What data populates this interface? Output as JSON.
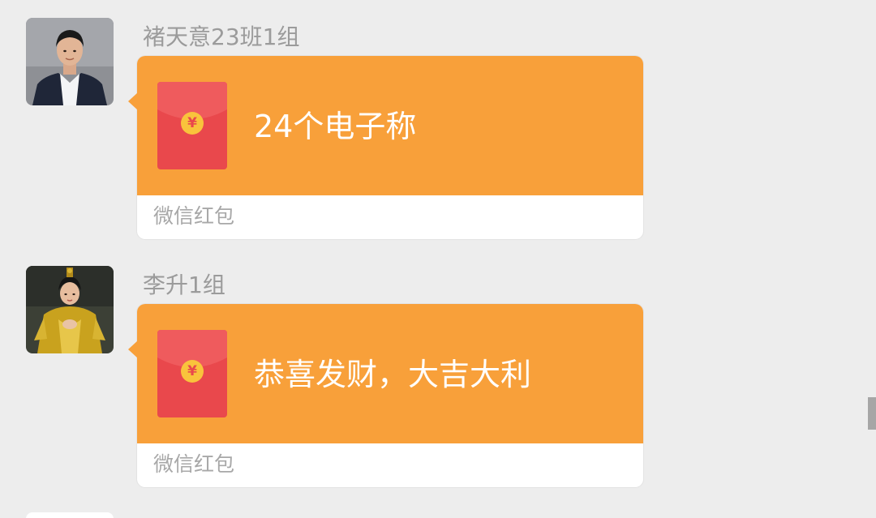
{
  "messages": [
    {
      "sender": "褚天意23班1组",
      "greeting": "24个电子称",
      "footer": "微信红包",
      "avatar": "avatar-man-suit"
    },
    {
      "sender": "李升1组",
      "greeting": "恭喜发财，大吉大利",
      "footer": "微信红包",
      "avatar": "avatar-girl-costume"
    }
  ],
  "red_packet": {
    "coin_symbol": "¥",
    "card_color": "#f8a03a",
    "envelope_color": "#e9484c",
    "coin_color": "#f9c33c"
  }
}
